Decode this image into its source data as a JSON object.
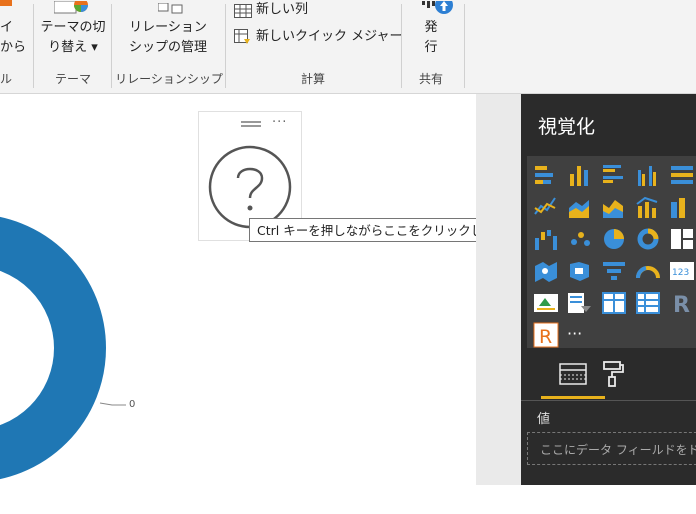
{
  "ribbon": {
    "partial_group": {
      "line1": "イ",
      "line2": "から",
      "label": "ル"
    },
    "theme": {
      "line1": "テーマの切",
      "line2": "り替え ▾",
      "label": "テーマ"
    },
    "relationship": {
      "line1": "リレーション",
      "line2": "シップの管理",
      "label": "リレーションシップ"
    },
    "calc": {
      "new_column": "新しい列",
      "new_quick_measure": "新しいクイック メジャー",
      "label": "計算"
    },
    "publish": {
      "line1": "発",
      "line2": "行",
      "label": "共有"
    }
  },
  "canvas": {
    "donut_label": "0",
    "tooltip": "Ctrl キーを押しながらここをクリックして、リンク先をフォローします"
  },
  "visualizations": {
    "title": "視覚化",
    "more": "···",
    "value_label": "値",
    "value_placeholder": "ここにデータ フィールドをドラ"
  },
  "colors": {
    "accent_blue": "#1f77b4",
    "dark_panel": "#2b2b2b",
    "orange": "#e8711c"
  }
}
